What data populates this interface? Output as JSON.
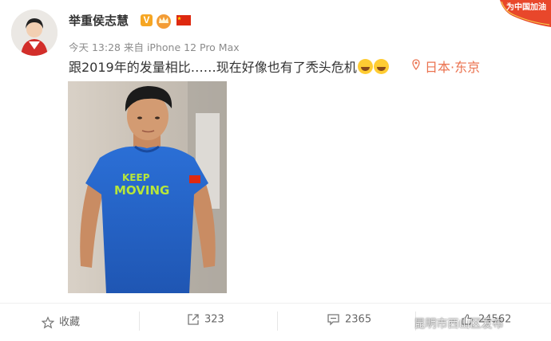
{
  "post": {
    "username": "举重侯志慧",
    "verified_badge": "V",
    "timestamp": "今天 13:28",
    "source": "来自 iPhone 12 Pro Max",
    "text": "跟2019年的发量相比……现在好像也有了秃头危机",
    "location": "日本·东京",
    "corner_banner": "为中国加油"
  },
  "photo": {
    "shirt_text_line1": "KEEP",
    "shirt_text_line2": "MOVING"
  },
  "actions": {
    "favorite_label": "收藏",
    "repost_count": "323",
    "comment_count": "2365",
    "like_count": "24562"
  },
  "watermark": "昆明市西山区发布",
  "colors": {
    "location": "#eb7350",
    "verified_badge": "#f6a623",
    "banner": "#e8472b"
  }
}
